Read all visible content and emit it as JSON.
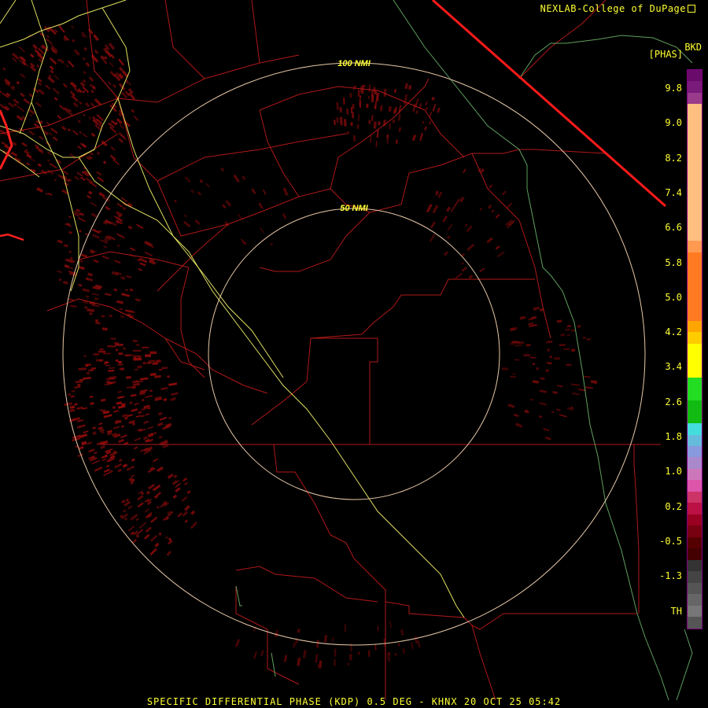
{
  "credit": "NEXLAB-College of DuPage",
  "station": "BKD",
  "units": "[PHAS]",
  "scale_ticks": [
    "9.8",
    "9.0",
    "8.2",
    "7.4",
    "6.6",
    "5.8",
    "5.0",
    "4.2",
    "3.4",
    "2.6",
    "1.8",
    "1.0",
    "0.2",
    "-0.5",
    "-1.3",
    "TH"
  ],
  "scale_colors": [
    "#6a0a6a",
    "#7a1a7a",
    "#9a3a8a",
    "#ffbf80",
    "#ffbf80",
    "#ffbf80",
    "#ffbf80",
    "#ffbf80",
    "#ffbf80",
    "#ffbf80",
    "#ffbf80",
    "#ffbf80",
    "#ffbf80",
    "#ffbf80",
    "#ffbf80",
    "#ff9a50",
    "#ff7a20",
    "#ff7a20",
    "#ff7a20",
    "#ff7a20",
    "#ff7a20",
    "#ff7a20",
    "#ffa500",
    "#ffcc00",
    "#ffff00",
    "#ffff00",
    "#ffff00",
    "#22dd22",
    "#22dd22",
    "#11bb11",
    "#11bb11",
    "#44dddd",
    "#66bbdd",
    "#8899dd",
    "#aa88cc",
    "#cc77bb",
    "#dd55aa",
    "#cc3366",
    "#bb1144",
    "#990022",
    "#770011",
    "#550000",
    "#440000",
    "#333333",
    "#444444",
    "#555555",
    "#666666",
    "#777777",
    "#555555"
  ],
  "ring_labels": {
    "outer": "100 NMI",
    "inner": "50 NMI"
  },
  "footer": "SPECIFIC DIFFERENTIAL PHASE (KDP) 0.5 DEG - KHNX 20 OCT 25 05:42"
}
